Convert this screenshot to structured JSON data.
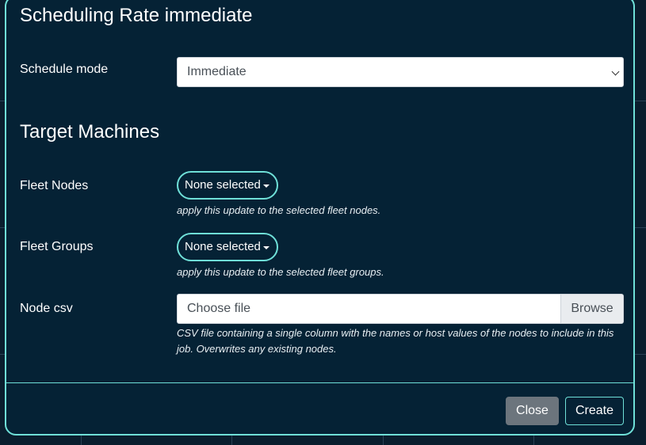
{
  "scheduling": {
    "title": "Scheduling Rate immediate",
    "mode_label": "Schedule mode",
    "mode_value": "Immediate"
  },
  "targets": {
    "title": "Target Machines",
    "fleet_nodes": {
      "label": "Fleet Nodes",
      "button": "None selected",
      "help": "apply this update to the selected fleet nodes."
    },
    "fleet_groups": {
      "label": "Fleet Groups",
      "button": "None selected",
      "help": "apply this update to the selected fleet groups."
    },
    "node_csv": {
      "label": "Node csv",
      "placeholder": "Choose file",
      "browse": "Browse",
      "help": "CSV file containing a single column with the names or host values of the nodes to include in this job. Overwrites any existing nodes."
    }
  },
  "footer": {
    "close_label": "Close",
    "create_label": "Create"
  },
  "colors": {
    "modal_bg": "#052235",
    "accent": "#6fe0d8",
    "secondary_button": "#6c757d"
  }
}
